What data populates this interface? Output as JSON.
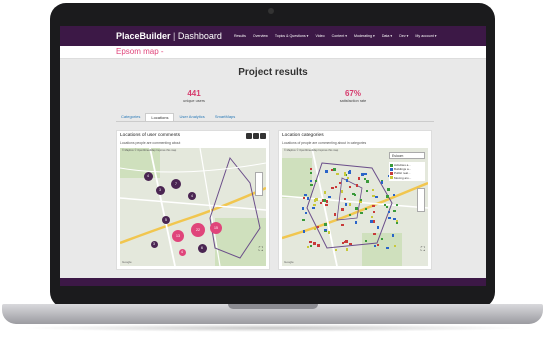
{
  "nav": {
    "brand": "PlaceBuilder",
    "separator": "|",
    "section": "Dashboard",
    "items": [
      "Results",
      "Overview",
      "Topics & Questions ▾",
      "Video",
      "Content ▾",
      "Moderating ▾",
      "Data ▾",
      "Dev ▾",
      "My account ▾"
    ]
  },
  "page": {
    "subtitle": "Epsom map -",
    "heading": "Project results"
  },
  "stats": [
    {
      "value": "441",
      "label": "unique users"
    },
    {
      "value": "67%",
      "label": "satisfaction rate"
    }
  ],
  "tabs": [
    {
      "label": "Categories",
      "active": false
    },
    {
      "label": "Locations",
      "active": true
    },
    {
      "label": "User Analytics",
      "active": false
    },
    {
      "label": "SmartMaps",
      "active": false
    }
  ],
  "panels": {
    "left": {
      "title": "Locations of user comments",
      "subtitle": "Locations people are commenting about",
      "map_note": "© Mapbox © OpenStreetMap Improve this map",
      "clusters": [
        {
          "count": "4",
          "color": "#4a2552"
        },
        {
          "count": "3",
          "color": "#4a2552"
        },
        {
          "count": "7",
          "color": "#4a2552"
        },
        {
          "count": "4",
          "color": "#4a2552"
        },
        {
          "count": "5",
          "color": "#4a2552"
        },
        {
          "count": "13",
          "color": "#e0457b"
        },
        {
          "count": "22",
          "color": "#e0457b"
        },
        {
          "count": "15",
          "color": "#e0457b"
        },
        {
          "count": "4",
          "color": "#e0457b"
        },
        {
          "count": "6",
          "color": "#4a2552"
        },
        {
          "count": "3",
          "color": "#4a2552"
        }
      ]
    },
    "right": {
      "title": "Location categories",
      "subtitle": "Locations of people are commenting about in categories",
      "map_note": "© Mapbox © OpenStreetMap Improve this map",
      "dropdown": "Esloom",
      "legend": [
        {
          "label": "Activities a...",
          "color": "#3a9a3a"
        },
        {
          "label": "Buildings a...",
          "color": "#2a64c8"
        },
        {
          "label": "Public real...",
          "color": "#c83a3a"
        },
        {
          "label": "Moving aro...",
          "color": "#c8c83a"
        }
      ]
    }
  },
  "colors": {
    "accent": "#e0457b",
    "nav": "#3c1846"
  }
}
